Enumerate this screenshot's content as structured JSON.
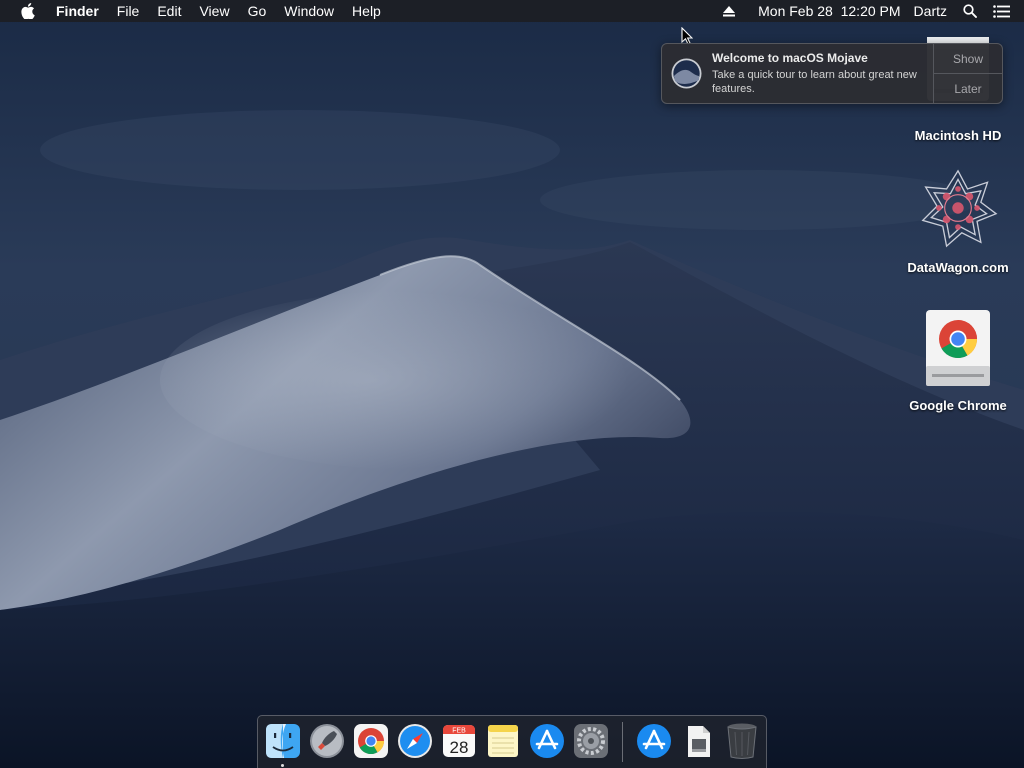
{
  "menubar": {
    "apple_icon": "apple-icon",
    "app_name": "Finder",
    "menus": [
      "File",
      "Edit",
      "View",
      "Go",
      "Window",
      "Help"
    ],
    "status": {
      "eject_icon": "eject-icon",
      "datetime": "Mon Feb 28  12:20 PM",
      "user": "Dartz",
      "search_icon": "spotlight-search-icon",
      "notification_icon": "notification-center-icon"
    }
  },
  "notification": {
    "title": "Welcome to macOS Mojave",
    "body": "Take a quick tour to learn about great new features.",
    "show_label": "Show",
    "later_label": "Later"
  },
  "desktop_icons": [
    {
      "label": "Macintosh HD",
      "icon": "hard-drive-icon"
    },
    {
      "label": "DataWagon.com",
      "icon": "datawagon-logo-icon"
    },
    {
      "label": "Google Chrome",
      "icon": "chrome-disk-image-icon"
    }
  ],
  "dock": {
    "apps": [
      {
        "name": "Finder",
        "icon": "finder-icon",
        "running": true
      },
      {
        "name": "Launchpad",
        "icon": "launchpad-icon",
        "running": false
      },
      {
        "name": "Google Chrome",
        "icon": "chrome-icon",
        "running": false
      },
      {
        "name": "Safari",
        "icon": "safari-icon",
        "running": false
      },
      {
        "name": "Calendar",
        "icon": "calendar-icon",
        "running": false
      },
      {
        "name": "Notes",
        "icon": "notes-icon",
        "running": false
      },
      {
        "name": "App Store",
        "icon": "app-store-icon",
        "running": false
      },
      {
        "name": "System Preferences",
        "icon": "system-preferences-icon",
        "running": false
      },
      {
        "name": "App Store (recent)",
        "icon": "app-store-icon",
        "running": false
      },
      {
        "name": "Downloads",
        "icon": "document-stack-icon",
        "running": false
      },
      {
        "name": "Trash",
        "icon": "trash-icon",
        "running": false
      }
    ],
    "calendar_month": "FEB",
    "calendar_day": "28"
  }
}
